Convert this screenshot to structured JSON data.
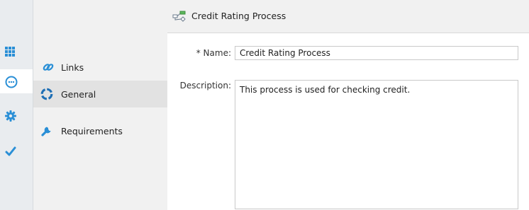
{
  "header": {
    "title": "Credit Rating Process",
    "icon": "process-diagram-icon"
  },
  "rail": {
    "items": [
      {
        "icon": "grid-icon",
        "active": false
      },
      {
        "icon": "chat-bubble-icon",
        "active": true
      },
      {
        "icon": "gear-icon",
        "active": false
      },
      {
        "icon": "checkmark-icon",
        "active": false
      }
    ],
    "accent_color": "#2a8fd6"
  },
  "nav": {
    "items": [
      {
        "label": "Links",
        "icon": "links-icon",
        "active": false
      },
      {
        "label": "General",
        "icon": "general-ring-icon",
        "active": true
      },
      {
        "label": "Requirements",
        "icon": "wrench-icon",
        "active": false
      }
    ]
  },
  "form": {
    "name_label_required": "*",
    "name_label": "Name:",
    "name_value": "Credit Rating Process",
    "description_label": "Description:",
    "description_value": "This process is used for checking credit."
  }
}
